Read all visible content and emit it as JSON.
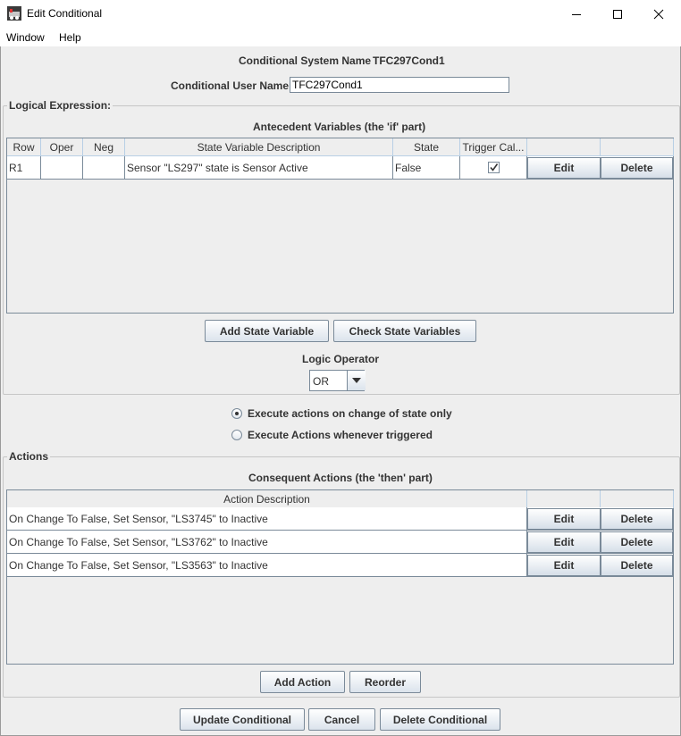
{
  "window": {
    "title": "Edit Conditional",
    "controls": [
      "minimize",
      "maximize",
      "close"
    ]
  },
  "menu": {
    "items": [
      "Window",
      "Help"
    ]
  },
  "header": {
    "system_name_label": "Conditional System Name",
    "system_name_value": "TFC297Cond1",
    "user_name_label": "Conditional User Name",
    "user_name_value": "TFC297Cond1"
  },
  "logical": {
    "legend": "Logical Expression:",
    "table_title": "Antecedent Variables (the 'if' part)",
    "columns": [
      "Row",
      "Oper",
      "Neg",
      "State Variable Description",
      "State",
      "Trigger Cal...",
      "",
      ""
    ],
    "rows": [
      {
        "row": "R1",
        "oper": "",
        "neg": "",
        "description": "Sensor \"LS297\" state is Sensor Active",
        "state": "False",
        "trigger_checked": true,
        "edit_label": "Edit",
        "delete_label": "Delete"
      }
    ],
    "add_state_variable_label": "Add State Variable",
    "check_state_variables_label": "Check State Variables",
    "logic_operator_label": "Logic Operator",
    "logic_operator_value": "OR"
  },
  "execute_options": {
    "selected_index": 0,
    "options": [
      "Execute actions on change of state only",
      "Execute Actions whenever triggered"
    ]
  },
  "actions": {
    "legend": "Actions",
    "table_title": "Consequent Actions (the 'then' part)",
    "columns": [
      "Action Description",
      "",
      ""
    ],
    "rows": [
      {
        "description": "On Change To False, Set Sensor, \"LS3745\" to Inactive",
        "edit_label": "Edit",
        "delete_label": "Delete"
      },
      {
        "description": "On Change To False, Set Sensor, \"LS3762\" to Inactive",
        "edit_label": "Edit",
        "delete_label": "Delete"
      },
      {
        "description": "On Change To False, Set Sensor, \"LS3563\" to Inactive",
        "edit_label": "Edit",
        "delete_label": "Delete"
      }
    ],
    "add_action_label": "Add Action",
    "reorder_label": "Reorder"
  },
  "footer": {
    "update_label": "Update Conditional",
    "cancel_label": "Cancel",
    "delete_label": "Delete Conditional"
  }
}
